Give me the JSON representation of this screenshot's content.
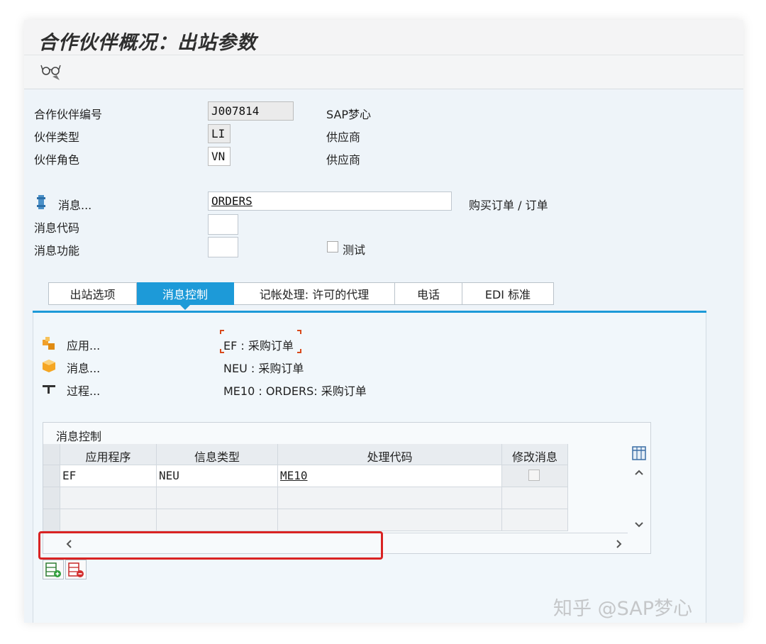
{
  "window": {
    "title": "合作伙伴概况：出站参数"
  },
  "toolbar": {
    "display_icon": "glasses-icon"
  },
  "header_fields": {
    "partner_no": {
      "label": "合作伙伴编号",
      "value": "J007814",
      "desc": "SAP梦心"
    },
    "partner_type": {
      "label": "伙伴类型",
      "value": "LI",
      "desc": "供应商"
    },
    "partner_role": {
      "label": "伙伴角色",
      "value": "VN",
      "desc": "供应商"
    },
    "message": {
      "label": "消息...",
      "value": "ORDERS",
      "desc": "购买订单 / 订单"
    },
    "message_code": {
      "label": "消息代码",
      "value": ""
    },
    "message_function": {
      "label": "消息功能",
      "value": ""
    },
    "test": {
      "label": "测试",
      "checked": false
    }
  },
  "tabs": [
    {
      "label": "出站选项",
      "active": false
    },
    {
      "label": "消息控制",
      "active": true
    },
    {
      "label": "记帐处理: 许可的代理",
      "active": false
    },
    {
      "label": "电话",
      "active": false
    },
    {
      "label": "EDI 标准",
      "active": false
    }
  ],
  "message_control": {
    "application": {
      "label": "应用...",
      "value": "EF : 采购订单"
    },
    "output_type": {
      "label": "消息...",
      "value": "NEU : 采购订单"
    },
    "process": {
      "label": "过程...",
      "value": "ME10 : ORDERS: 采购订单"
    }
  },
  "grid": {
    "title": "消息控制",
    "columns": [
      "应用程序",
      "信息类型",
      "处理代码",
      "修改消息"
    ],
    "rows": [
      {
        "application": "EF",
        "output_type": "NEU",
        "process_code": "ME10",
        "change": false
      },
      {
        "application": "",
        "output_type": "",
        "process_code": "",
        "change": null
      },
      {
        "application": "",
        "output_type": "",
        "process_code": "",
        "change": null
      }
    ]
  },
  "watermark": "知乎 @SAP梦心",
  "colors": {
    "accent": "#1d9ad8",
    "highlight": "#d92323"
  }
}
